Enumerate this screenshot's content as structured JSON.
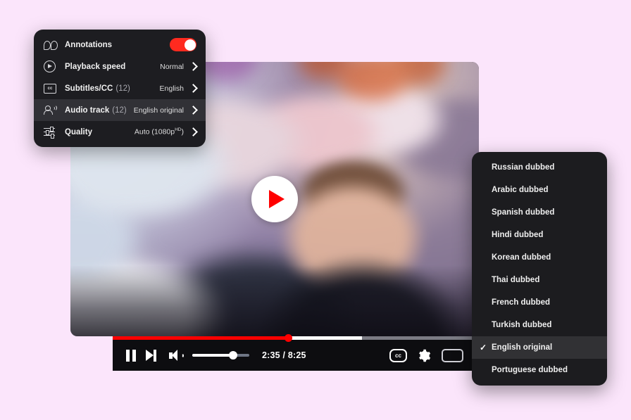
{
  "page": {
    "background_color": "#fbe5fb"
  },
  "video_player": {
    "name": "youtube-video-player",
    "play_button_label": "Play",
    "overlay_icon": "play-icon",
    "controls": {
      "pause_label": "Pause",
      "next_label": "Next video",
      "volume_label": "Mute",
      "volume_level_percent": 72,
      "time_display": "2:35 / 8:25",
      "current_time": "2:35",
      "duration": "8:25",
      "progress_percent": 48,
      "buffered_percent": 68,
      "subtitles_label": "CC",
      "subtitles_icon": "closed-captions-icon",
      "settings_label": "Settings",
      "settings_icon": "gear-icon",
      "fullscreen_label": "Full screen",
      "fullscreen_icon": "fullscreen-icon",
      "progress_color": "#ff0000",
      "buffer_color": "#ffffff",
      "track_color": "#7b7b84"
    }
  },
  "settings_menu": {
    "name": "player-settings-menu",
    "items": [
      {
        "icon": "annotations-icon",
        "label": "Annotations",
        "count": "",
        "value": "",
        "control": "toggle",
        "toggle_on": true,
        "toggle_color": "#ff2a1f",
        "active": false
      },
      {
        "icon": "playback-speed-icon",
        "label": "Playback speed",
        "count": "",
        "value": "Normal",
        "control": "chevron",
        "active": false
      },
      {
        "icon": "closed-captions-icon",
        "label": "Subtitles/CC",
        "count": "(12)",
        "value": "English",
        "control": "chevron",
        "active": false
      },
      {
        "icon": "audio-track-icon",
        "label": "Audio track",
        "count": "(12)",
        "value": "English original",
        "control": "chevron",
        "active": true
      },
      {
        "icon": "quality-icon",
        "label": "Quality",
        "count": "",
        "value": "Auto (1080p",
        "value_sup": "HD",
        "value_suffix": ")",
        "control": "chevron",
        "active": false
      }
    ]
  },
  "audio_track_menu": {
    "name": "audio-track-dropdown",
    "selected": "English original",
    "check_glyph": "✓",
    "options": [
      {
        "label": "Russian dubbed",
        "selected": false
      },
      {
        "label": "Arabic dubbed",
        "selected": false
      },
      {
        "label": "Spanish dubbed",
        "selected": false
      },
      {
        "label": "Hindi dubbed",
        "selected": false
      },
      {
        "label": "Korean dubbed",
        "selected": false
      },
      {
        "label": "Thai dubbed",
        "selected": false
      },
      {
        "label": "French dubbed",
        "selected": false
      },
      {
        "label": "Turkish dubbed",
        "selected": false
      },
      {
        "label": "English original",
        "selected": true
      },
      {
        "label": "Portuguese dubbed",
        "selected": false
      }
    ]
  }
}
